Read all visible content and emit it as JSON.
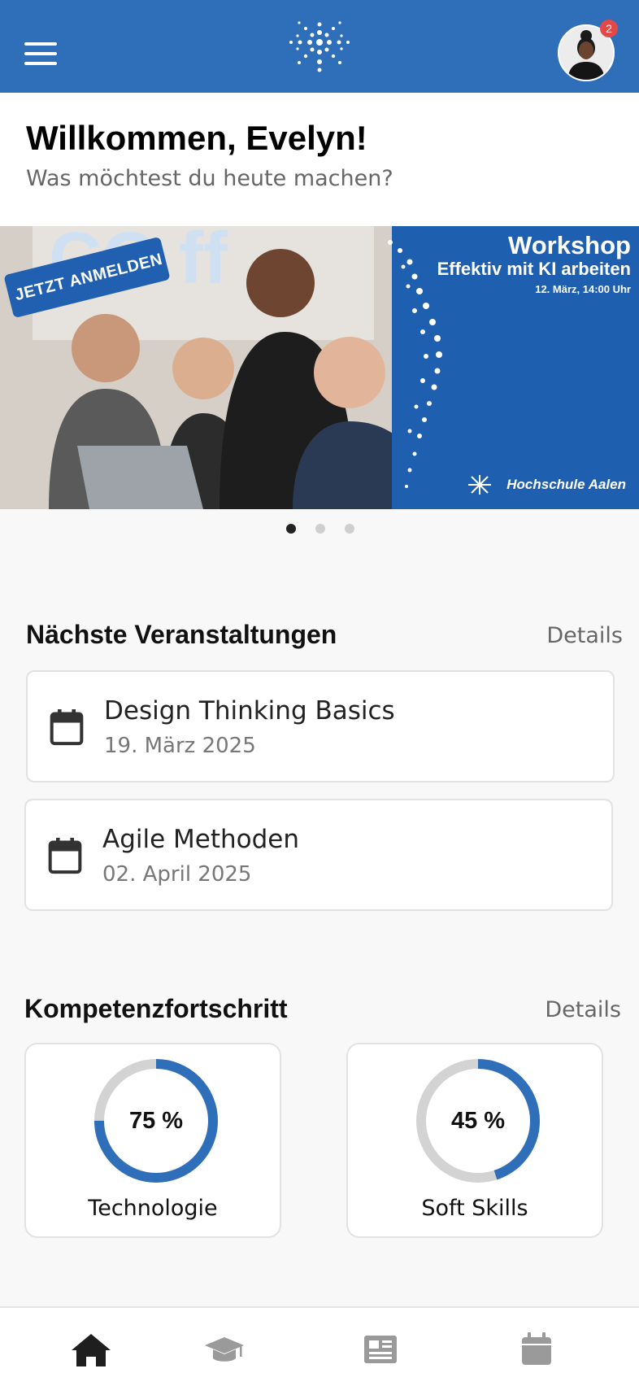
{
  "header": {
    "notification_count": "2",
    "brand_color": "#2f6fba"
  },
  "welcome": {
    "title": "Willkommen, Evelyn!",
    "subtitle": "Was möchtest du heute machen?"
  },
  "banner": {
    "cta": "JETZT ANMELDEN",
    "title": "Workshop",
    "subtitle": "Effektiv mit KI arbeiten",
    "date": "12. März, 14:00 Uhr",
    "brand": "Hochschule Aalen",
    "slide_count": 3,
    "active_slide": 1
  },
  "events": {
    "title": "Nächste Veranstaltungen",
    "details_label": "Details",
    "items": [
      {
        "title": "Design Thinking Basics",
        "date": "19. März 2025",
        "icon": "calendar-icon"
      },
      {
        "title": "Agile Methoden",
        "date": "02. April 2025",
        "icon": "calendar-icon"
      }
    ]
  },
  "competence": {
    "title": "Kompetenzfortschritt",
    "details_label": "Details",
    "items": [
      {
        "label": "Technologie",
        "value_text": "75 %",
        "value": 0.75
      },
      {
        "label": "Soft Skills",
        "value_text": "45 %",
        "value": 0.45
      }
    ],
    "ring_color": "#2f6fba",
    "track_color": "#d3d3d3"
  },
  "nav": {
    "items": [
      {
        "icon": "home-icon",
        "active": true
      },
      {
        "icon": "graduation-cap-icon",
        "active": false
      },
      {
        "icon": "news-icon",
        "active": false
      },
      {
        "icon": "calendar-icon",
        "active": false
      }
    ]
  }
}
